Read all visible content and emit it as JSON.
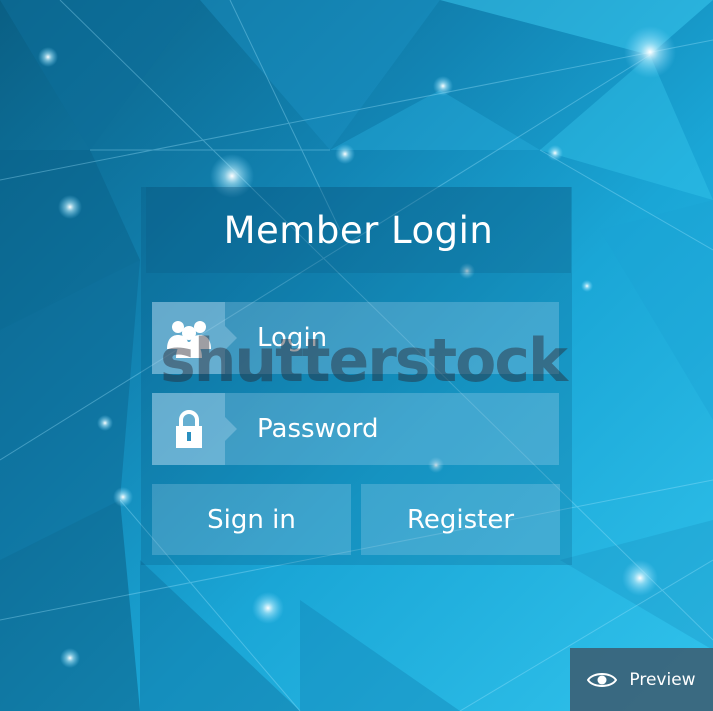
{
  "form": {
    "title": "Member Login",
    "login_field": {
      "label": "Login",
      "icon": "users-icon"
    },
    "password_field": {
      "label": "Password",
      "icon": "lock-icon"
    },
    "signin_label": "Sign in",
    "register_label": "Register"
  },
  "watermark": {
    "text": "shutterstock"
  },
  "preview": {
    "label": "Preview",
    "icon": "eye-icon"
  },
  "colors": {
    "background_dark": "#0a5f84",
    "background_light": "#31c3ec",
    "text": "#ffffff"
  }
}
